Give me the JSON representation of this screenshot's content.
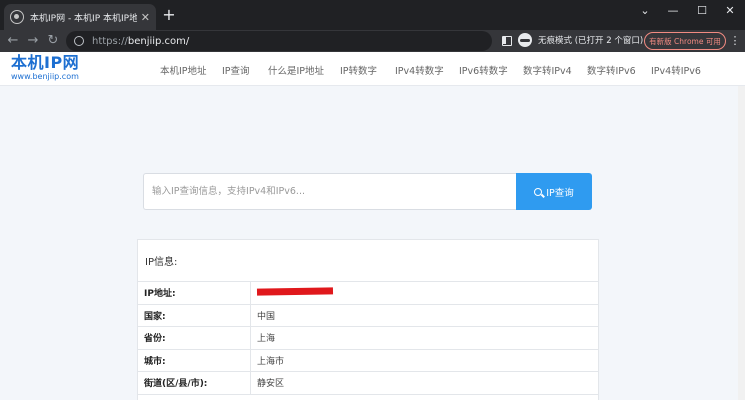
{
  "browser": {
    "tab_title": "本机IP网 - 本机IP 本机IP地址 本",
    "url_scheme": "https://",
    "url_host": "benjiip.com/",
    "incognito_label": "无痕模式 (已打开 2 个窗口)",
    "update_label": "有新版 Chrome 可用"
  },
  "site": {
    "logo_main": "本机IP网",
    "logo_sub": "www.benjiip.com",
    "nav": [
      "本机IP地址",
      "IP查询",
      "什么是IP地址",
      "IP转数字",
      "IPv4转数字",
      "IPv6转数字",
      "数字转IPv4",
      "数字转IPv6",
      "IPv4转IPv6"
    ]
  },
  "search": {
    "placeholder": "输入IP查询信息，支持IPv4和IPv6...",
    "button": "IP查询"
  },
  "info": {
    "title": "IP信息:",
    "rows": [
      {
        "key": "IP地址:",
        "value": ""
      },
      {
        "key": "国家:",
        "value": "中国"
      },
      {
        "key": "省份:",
        "value": "上海"
      },
      {
        "key": "城市:",
        "value": "上海市"
      },
      {
        "key": "街道(区/县/市):",
        "value": "静安区"
      }
    ]
  }
}
